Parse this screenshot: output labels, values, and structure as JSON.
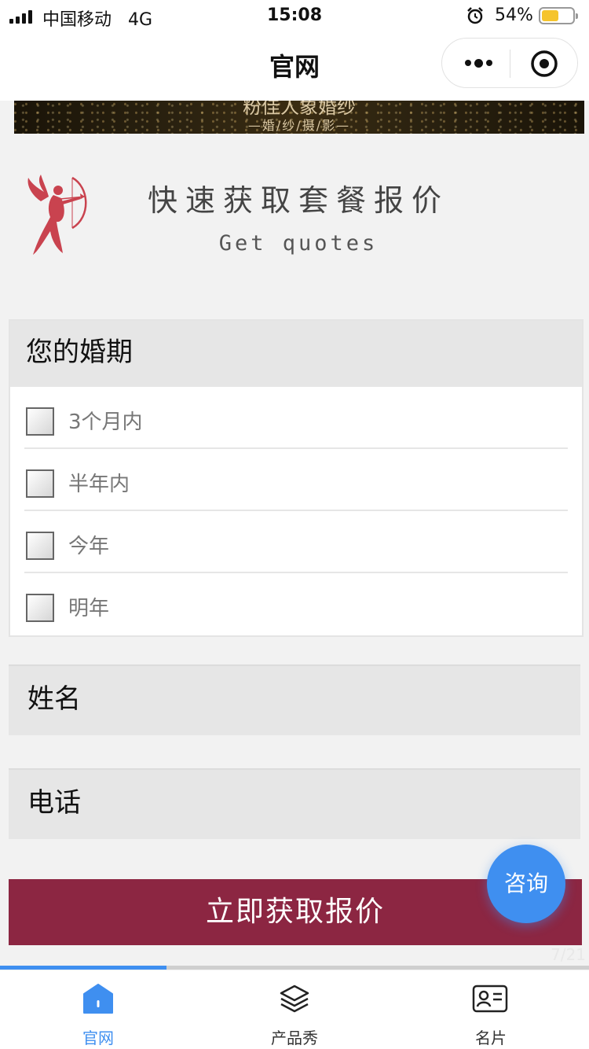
{
  "status_bar": {
    "carrier": "中国移动",
    "network": "4G",
    "time": "15:08",
    "battery_pct": "54%",
    "battery_level": 0.54
  },
  "nav": {
    "title": "官网",
    "more_icon": "more-dots-icon",
    "close_icon": "target-close-icon"
  },
  "banner": {
    "line1": "粉佳人象婚纱",
    "line2": "—婚/纱/摄/影—"
  },
  "quote_header": {
    "title": "快速获取套餐报价",
    "subtitle": "Get quotes",
    "logo_icon": "cupid-archer-icon"
  },
  "wedding_date": {
    "heading": "您的婚期",
    "options": [
      {
        "label": "3个月内",
        "checked": false
      },
      {
        "label": "半年内",
        "checked": false
      },
      {
        "label": "今年",
        "checked": false
      },
      {
        "label": "明年",
        "checked": false
      }
    ]
  },
  "fields": {
    "name_placeholder": "姓名",
    "phone_placeholder": "电话"
  },
  "submit_label": "立即获取报价",
  "consult_label": "咨询",
  "pager": {
    "text": "7/21",
    "progress": 0.2833
  },
  "tabs": [
    {
      "label": "官网",
      "icon": "home-icon",
      "active": true
    },
    {
      "label": "产品秀",
      "icon": "layers-icon",
      "active": false
    },
    {
      "label": "名片",
      "icon": "id-card-icon",
      "active": false
    }
  ],
  "colors": {
    "accent": "#3f8ff0",
    "submit": "#8c2642",
    "logo": "#c9434f"
  }
}
